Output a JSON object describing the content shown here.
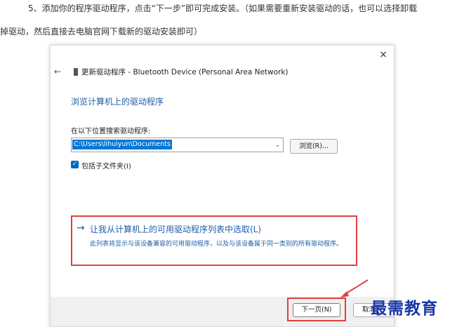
{
  "article": {
    "line1": "5、添加你的程序驱动程序，点击“下一步”即可完成安装。（如果需要重新安装驱动的话，也可以选择卸载",
    "line2": "掉驱动，然后直接去电脑官网下载新的驱动安装即可）"
  },
  "dialog": {
    "close_icon": "×",
    "back_icon": "←",
    "window_title": "更新驱动程序 - Bluetooth Device (Personal Area Network)",
    "page_title": "浏览计算机上的驱动程序",
    "path_label": "在以下位置搜索驱动程序:",
    "path_value": "C:\\Users\\lihuiyun\\Documents",
    "combo_arrow": "⌄",
    "browse_label": "浏览(R)...",
    "checkbox_mark": "✓",
    "include_subfolders_label": "包括子文件夹(I)",
    "include_subfolders_checked": true,
    "pick_arrow": "→",
    "pick_title": "让我从计算机上的可用驱动程序列表中选取(L)",
    "pick_description": "此列表将显示与该设备兼容的可用驱动程序，以及与该设备属于同一类别的所有驱动程序。",
    "next_label": "下一页(N)",
    "cancel_label": "取消"
  },
  "watermark": "最需教育",
  "colors": {
    "accent_blue": "#1f5fa8",
    "highlight_red": "#e04040",
    "selection_blue": "#0078d7",
    "watermark_blue": "#1a36a8"
  }
}
